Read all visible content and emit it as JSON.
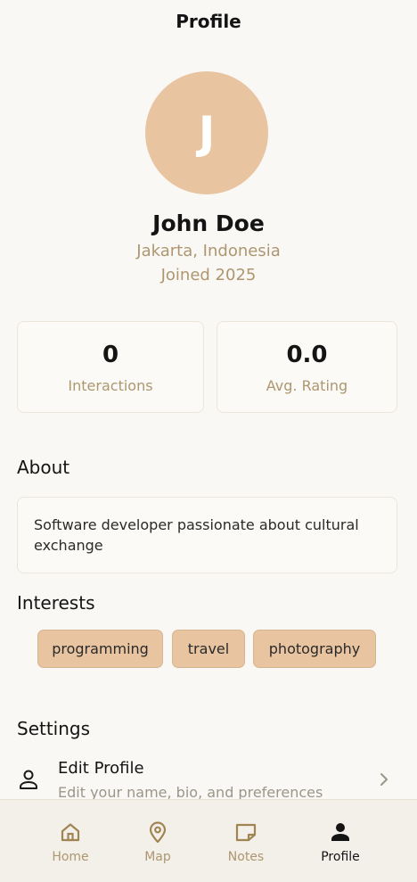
{
  "header": {
    "title": "Profile"
  },
  "profile": {
    "initial": "J",
    "name": "John Doe",
    "location": "Jakarta, Indonesia",
    "joined": "Joined 2025",
    "avatar_color": "#e8c4a0"
  },
  "stats": [
    {
      "value": "0",
      "label": "Interactions"
    },
    {
      "value": "0.0",
      "label": "Avg. Rating"
    }
  ],
  "about": {
    "heading": "About",
    "text": "Software developer passionate about cultural exchange"
  },
  "interests": {
    "heading": "Interests",
    "items": [
      "programming",
      "travel",
      "photography"
    ]
  },
  "settings": {
    "heading": "Settings",
    "items": [
      {
        "title": "Edit Profile",
        "subtitle": "Edit your name, bio, and preferences",
        "icon": "person-icon"
      }
    ]
  },
  "bottom_nav": {
    "items": [
      {
        "label": "Home",
        "icon": "home-icon",
        "active": false
      },
      {
        "label": "Map",
        "icon": "map-pin-icon",
        "active": false
      },
      {
        "label": "Notes",
        "icon": "note-icon",
        "active": false
      },
      {
        "label": "Profile",
        "icon": "person-icon",
        "active": true
      }
    ]
  },
  "colors": {
    "accent": "#e8c4a0",
    "muted_text": "#ad9670",
    "background": "#faf8f5"
  }
}
